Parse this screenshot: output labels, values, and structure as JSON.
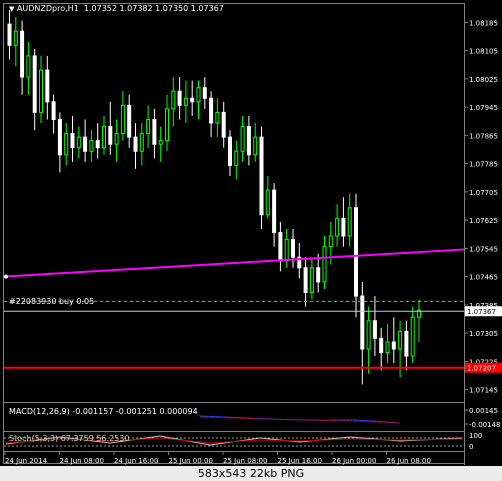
{
  "window": {
    "symbol": "AUDNZDpro,H1",
    "ohlc": "1.07352 1.07382 1.07350 1.07367",
    "footer": "583x543  22kb  PNG"
  },
  "price_axis": {
    "ticks": [
      "1.08185",
      "1.08105",
      "1.08025",
      "1.07945",
      "1.07865",
      "1.07785",
      "1.07705",
      "1.07625",
      "1.07545",
      "1.07465",
      "1.07385",
      "1.07305",
      "1.07225",
      "1.07145"
    ],
    "ymin": 1.0711,
    "ymax": 1.0822,
    "current_price": "1.07367",
    "red_price": "1.07207",
    "pink_start": "1.07465"
  },
  "time_axis": [
    "24 Jun 2014",
    "24 Jun 08:00",
    "24 Jun 16:00",
    "25 Jun 00:00",
    "25 Jun 08:00",
    "25 Jun 16:00",
    "26 Jun 00:00",
    "26 Jun 08:00"
  ],
  "order": {
    "label": "#22083930 buy 0.05",
    "price": 1.07395
  },
  "colors": {
    "bull": "#00ff00",
    "bear": "#ffffff",
    "pink": "#ff00ff",
    "red": "#ff0000",
    "macd": "#3a3aff",
    "signal": "#c00000"
  },
  "macd": {
    "label": "MACD(12,26,9) -0.001157 -0.001251 0.000094",
    "ticks": [
      "0.00145",
      "-0.00148"
    ]
  },
  "stoch": {
    "label": "Stoch(5,3,3) 67.3759 56.2530",
    "ticks": [
      "100",
      "0"
    ]
  },
  "chart_data": {
    "type": "candlestick",
    "candles": [
      [
        1.0818,
        1.0822,
        1.0808,
        1.0812
      ],
      [
        1.0812,
        1.082,
        1.0806,
        1.0816
      ],
      [
        1.0816,
        1.0819,
        1.0798,
        1.0803
      ],
      [
        1.0803,
        1.0813,
        1.0798,
        1.0809
      ],
      [
        1.0809,
        1.0811,
        1.0788,
        1.0793
      ],
      [
        1.0793,
        1.0809,
        1.079,
        1.0805
      ],
      [
        1.0805,
        1.0809,
        1.0791,
        1.0796
      ],
      [
        1.0796,
        1.0798,
        1.0787,
        1.0791
      ],
      [
        1.0791,
        1.0793,
        1.0776,
        1.0781
      ],
      [
        1.0781,
        1.079,
        1.0778,
        1.0787
      ],
      [
        1.0787,
        1.0792,
        1.0779,
        1.0783
      ],
      [
        1.0783,
        1.0789,
        1.078,
        1.0786
      ],
      [
        1.0786,
        1.0791,
        1.0779,
        1.0782
      ],
      [
        1.0782,
        1.0788,
        1.0779,
        1.0785
      ],
      [
        1.0785,
        1.079,
        1.078,
        1.0783
      ],
      [
        1.0783,
        1.0792,
        1.0781,
        1.0789
      ],
      [
        1.0789,
        1.0796,
        1.0781,
        1.0784
      ],
      [
        1.0784,
        1.0791,
        1.0779,
        1.0787
      ],
      [
        1.0787,
        1.0799,
        1.0785,
        1.0795
      ],
      [
        1.0795,
        1.0798,
        1.0783,
        1.0786
      ],
      [
        1.0786,
        1.079,
        1.0777,
        1.0782
      ],
      [
        1.0782,
        1.079,
        1.0778,
        1.0787
      ],
      [
        1.0787,
        1.0795,
        1.0783,
        1.0791
      ],
      [
        1.0791,
        1.0794,
        1.078,
        1.0784
      ],
      [
        1.0784,
        1.0789,
        1.0779,
        1.0785
      ],
      [
        1.0785,
        1.0798,
        1.0782,
        1.0794
      ],
      [
        1.0794,
        1.0803,
        1.0789,
        1.0799
      ],
      [
        1.0799,
        1.0803,
        1.0791,
        1.0795
      ],
      [
        1.0795,
        1.0802,
        1.079,
        1.0797
      ],
      [
        1.0797,
        1.0802,
        1.0792,
        1.0796
      ],
      [
        1.0796,
        1.0802,
        1.0791,
        1.08
      ],
      [
        1.08,
        1.0803,
        1.0794,
        1.0797
      ],
      [
        1.0797,
        1.0799,
        1.0786,
        1.079
      ],
      [
        1.079,
        1.0797,
        1.0786,
        1.0793
      ],
      [
        1.0793,
        1.0796,
        1.0783,
        1.0786
      ],
      [
        1.0786,
        1.0788,
        1.0775,
        1.0778
      ],
      [
        1.0778,
        1.0785,
        1.0774,
        1.0782
      ],
      [
        1.0782,
        1.0792,
        1.0779,
        1.0789
      ],
      [
        1.0789,
        1.0792,
        1.0778,
        1.0781
      ],
      [
        1.0781,
        1.079,
        1.0779,
        1.0786
      ],
      [
        1.0786,
        1.0789,
        1.076,
        1.0764
      ],
      [
        1.0764,
        1.0775,
        1.0763,
        1.0771
      ],
      [
        1.0771,
        1.0773,
        1.0755,
        1.0759
      ],
      [
        1.0759,
        1.0762,
        1.0748,
        1.0751
      ],
      [
        1.0751,
        1.076,
        1.0749,
        1.0757
      ],
      [
        1.0757,
        1.076,
        1.0749,
        1.0752
      ],
      [
        1.0752,
        1.0756,
        1.0746,
        1.0749
      ],
      [
        1.0749,
        1.0752,
        1.0738,
        1.0742
      ],
      [
        1.0742,
        1.0752,
        1.074,
        1.0749
      ],
      [
        1.0749,
        1.0753,
        1.0742,
        1.0745
      ],
      [
        1.0745,
        1.0758,
        1.0743,
        1.0755
      ],
      [
        1.0755,
        1.0762,
        1.075,
        1.0758
      ],
      [
        1.0758,
        1.0767,
        1.0755,
        1.0763
      ],
      [
        1.0763,
        1.0769,
        1.0755,
        1.0758
      ],
      [
        1.0758,
        1.077,
        1.0755,
        1.0766
      ],
      [
        1.0766,
        1.077,
        1.0735,
        1.0741
      ],
      [
        1.0741,
        1.0745,
        1.0716,
        1.0726
      ],
      [
        1.0726,
        1.0738,
        1.0719,
        1.0734
      ],
      [
        1.0734,
        1.0741,
        1.0724,
        1.0729
      ],
      [
        1.0729,
        1.0732,
        1.072,
        1.0725
      ],
      [
        1.0725,
        1.0733,
        1.0722,
        1.0728
      ],
      [
        1.0728,
        1.0735,
        1.0722,
        1.0726
      ],
      [
        1.0726,
        1.0734,
        1.0718,
        1.0731
      ],
      [
        1.0731,
        1.0734,
        1.072,
        1.0724
      ],
      [
        1.0724,
        1.0738,
        1.0722,
        1.0735
      ],
      [
        1.0735,
        1.074,
        1.0728,
        1.0737
      ]
    ]
  }
}
